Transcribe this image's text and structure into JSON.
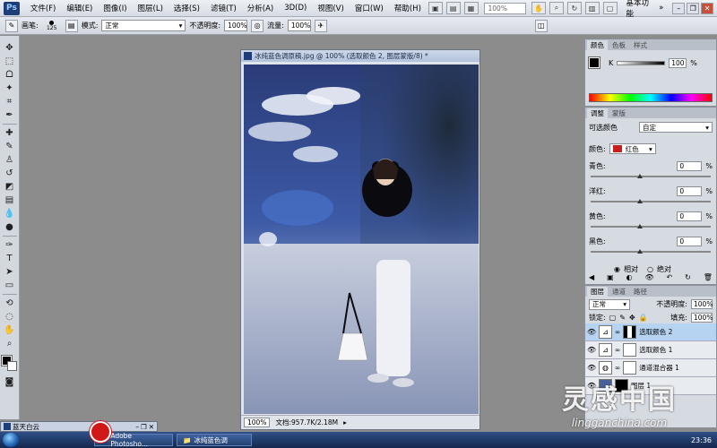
{
  "menubar": {
    "app_logo": "Ps",
    "items": [
      "文件(F)",
      "编辑(E)",
      "图像(I)",
      "图层(L)",
      "选择(S)",
      "滤镜(T)",
      "分析(A)",
      "3D(D)",
      "视图(V)",
      "窗口(W)",
      "帮助(H)"
    ],
    "zoom": "100%",
    "workspace": "基本功能"
  },
  "options": {
    "brush_label": "画笔:",
    "brush_size": "125",
    "mode_label": "模式:",
    "mode_value": "正常",
    "opacity_label": "不透明度:",
    "opacity_value": "100%",
    "flow_label": "流量:",
    "flow_value": "100%"
  },
  "document": {
    "title": "冰纯蓝色调原稿.jpg @ 100% (选取颜色 2, 图层蒙版/8) *",
    "zoom": "100%",
    "doc_info": "文档:957.7K/2.18M"
  },
  "color_panel": {
    "tabs": [
      "颜色",
      "色板",
      "样式"
    ],
    "channel": "K",
    "value": "100",
    "unit": "%"
  },
  "adjust_panel": {
    "tabs": [
      "调整",
      "蒙版"
    ],
    "preset_label": "可选颜色",
    "preset_value": "自定",
    "colors_label": "颜色:",
    "color_value": "红色",
    "swatch_color": "#c81e1e",
    "sliders": [
      {
        "label": "青色:",
        "value": "0",
        "unit": "%"
      },
      {
        "label": "洋红:",
        "value": "0",
        "unit": "%"
      },
      {
        "label": "黄色:",
        "value": "0",
        "unit": "%"
      },
      {
        "label": "黑色:",
        "value": "0",
        "unit": "%"
      }
    ],
    "method_relative": "相对",
    "method_absolute": "绝对"
  },
  "layers_panel": {
    "tabs": [
      "图层",
      "通道",
      "路径"
    ],
    "blend_mode": "正常",
    "opacity_label": "不透明度:",
    "opacity_value": "100%",
    "lock_label": "锁定:",
    "fill_label": "填充:",
    "fill_value": "100%",
    "layers": [
      {
        "name": "选取颜色 2",
        "selected": true
      },
      {
        "name": "选取颜色 1",
        "selected": false
      },
      {
        "name": "通道混合器 1",
        "selected": false
      },
      {
        "name": "图层 1",
        "selected": false
      }
    ]
  },
  "mini_window": {
    "title": "蓝天白云"
  },
  "taskbar": {
    "items": [
      "Adobe Photosho...",
      "冰纯蓝色调"
    ],
    "clock": "23:36"
  },
  "watermark": {
    "big": "灵感中国",
    "small": "lingganchina.com"
  }
}
